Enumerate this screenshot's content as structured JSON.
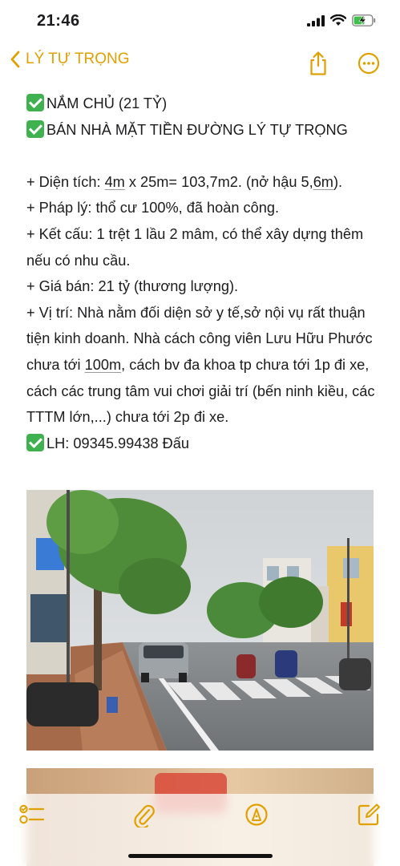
{
  "status_bar": {
    "time": "21:46"
  },
  "nav": {
    "back_label": "LÝ TỰ TRỌNG"
  },
  "note": {
    "lines": [
      "NẮM CHỦ (21 TỶ)",
      "BÁN NHÀ MẶT TIỀN ĐƯỜNG LÝ TỰ TRỌNG",
      "+ Diện tích: ",
      "4m",
      " x 25m= 103,7m2. (nở hậu 5,",
      "6m",
      ").",
      "+ Pháp lý: thổ cư 100%, đã hoàn công.",
      "+ Kết cấu: 1 trệt 1 lầu 2 mâm, có thể xây dựng thêm nếu có nhu cầu.",
      "+ Giá bán: 21 tỷ (thương lượng).",
      "+ Vị trí: Nhà nằm đối diện sở y tế,sở nội vụ rất thuận tiện kinh doanh. Nhà cách công viên Lưu Hữu Phước chưa tới ",
      "100m",
      ", cách bv đa khoa tp chưa tới 1p đi xe, cách các trung tâm vui chơi giải trí (bến ninh kiều, các TTTM lớn,...) chưa tới 2p đi xe.",
      "LH: 09345.99438 Đấu"
    ]
  },
  "colors": {
    "accent": "#e0a100",
    "check": "#3fb14f"
  },
  "icons": {
    "toolbar": [
      "checklist-icon",
      "attachment-icon",
      "markup-icon",
      "compose-icon"
    ],
    "nav": [
      "share-icon",
      "more-icon"
    ]
  }
}
